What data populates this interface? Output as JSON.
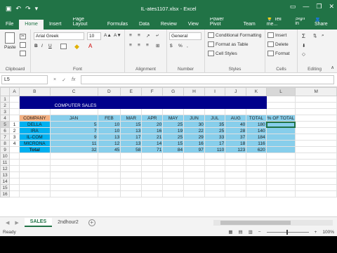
{
  "window": {
    "title": "IL-ates1107.xlsx - Excel"
  },
  "tabs": [
    "File",
    "Home",
    "Insert",
    "Page Layout",
    "Formulas",
    "Data",
    "Review",
    "View",
    "Power Pivot",
    "Team"
  ],
  "tell_me": "Tell me...",
  "sign_in": "Sign in",
  "share": "Share",
  "ribbon": {
    "clipboard": {
      "label": "Clipboard",
      "paste": "Paste"
    },
    "font": {
      "label": "Font",
      "name": "Arial Greek",
      "size": "10",
      "bold": "B",
      "italic": "I",
      "underline": "U"
    },
    "alignment": {
      "label": "Alignment"
    },
    "number": {
      "label": "Number",
      "format": "General",
      "percent": "%",
      "comma": ",",
      "currency": "$"
    },
    "styles": {
      "label": "Styles",
      "cond": "Conditional Formatting",
      "table": "Format as Table",
      "cell": "Cell Styles"
    },
    "cells": {
      "label": "Cells",
      "insert": "Insert",
      "delete": "Delete",
      "format": "Format"
    },
    "editing": {
      "label": "Editing"
    }
  },
  "formula_bar": {
    "name_box": "L5",
    "fx": "fx",
    "cancel": "×",
    "enter": "✓",
    "value": ""
  },
  "columns": [
    "A",
    "B",
    "C",
    "D",
    "E",
    "F",
    "G",
    "H",
    "I",
    "J",
    "K",
    "L",
    "M"
  ],
  "sheet": {
    "title": "COMPUTER SALES",
    "headers": [
      "COMPANY",
      "JAN",
      "FEB",
      "MAR",
      "APR",
      "MAY",
      "JUN",
      "JUL",
      "AUG",
      "TOTAL",
      "% OF TOTAL"
    ],
    "rows": [
      {
        "idx": "1",
        "company": "DELLA",
        "values": [
          "5",
          "10",
          "15",
          "20",
          "25",
          "30",
          "35",
          "40",
          "180"
        ]
      },
      {
        "idx": "2",
        "company": "IRA",
        "values": [
          "7",
          "10",
          "13",
          "16",
          "19",
          "22",
          "25",
          "28",
          "140"
        ]
      },
      {
        "idx": "3",
        "company": "IL-COM",
        "values": [
          "9",
          "13",
          "17",
          "21",
          "25",
          "29",
          "33",
          "37",
          "184"
        ]
      },
      {
        "idx": "4",
        "company": "MICRONA",
        "values": [
          "11",
          "12",
          "13",
          "14",
          "15",
          "16",
          "17",
          "18",
          "116"
        ]
      },
      {
        "idx": "",
        "company": "Total",
        "values": [
          "32",
          "45",
          "58",
          "71",
          "84",
          "97",
          "110",
          "123",
          "620"
        ]
      }
    ]
  },
  "sheet_tabs": [
    "SALES",
    "2ndhour2"
  ],
  "status": {
    "ready": "Ready",
    "zoom": "100%"
  },
  "colors": {
    "accent": "#217346",
    "title_band": "#00008b",
    "header_fill": "#f4b183",
    "company_fill": "#00b0f0",
    "data_fill": "#87ceeb"
  }
}
